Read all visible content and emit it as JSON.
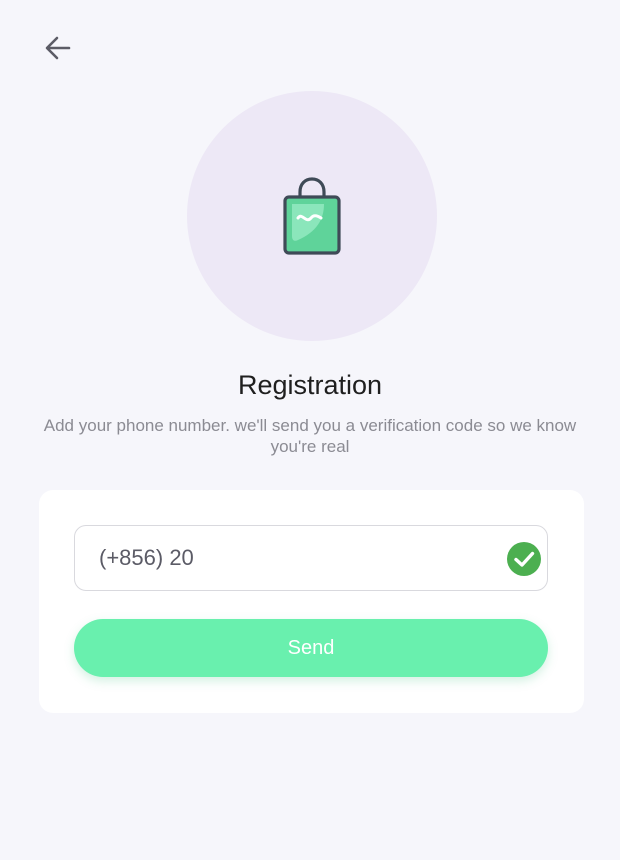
{
  "header": {
    "back_icon": "arrow-left-icon"
  },
  "hero": {
    "icon": "shopping-bag-icon",
    "circle_color": "#ede8f6",
    "bag_color": "#5fd39a"
  },
  "registration": {
    "title": "Registration",
    "subtitle": "Add your phone number. we'll send you a verification code so we know you're real"
  },
  "form": {
    "phone_value": "(+856) 20",
    "valid_icon": "check-circle-icon",
    "valid_color": "#4caf50",
    "send_label": "Send",
    "accent": "#69f0ae"
  }
}
